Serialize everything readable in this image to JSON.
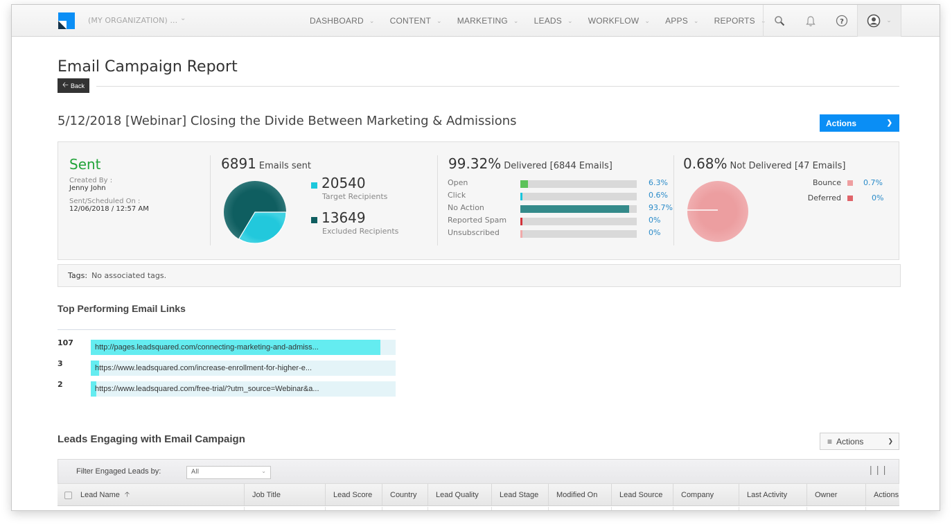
{
  "nav": {
    "org_name": "(MY ORGANIZATION) ...",
    "menu": [
      {
        "label": "DASHBOARD"
      },
      {
        "label": "CONTENT"
      },
      {
        "label": "MARKETING"
      },
      {
        "label": "LEADS"
      },
      {
        "label": "WORKFLOW"
      },
      {
        "label": "APPS"
      },
      {
        "label": "REPORTS"
      }
    ],
    "icons": [
      "search-icon",
      "bell-icon",
      "help-icon",
      "user-avatar-icon"
    ]
  },
  "page": {
    "title": "Email Campaign Report",
    "back_label": "Back",
    "campaign_title": "5/12/2018 [Webinar] Closing the Divide Between Marketing & Admissions",
    "actions_label": "Actions"
  },
  "summary": {
    "status": "Sent",
    "created_by_label": "Created By :",
    "created_by": "Jenny John",
    "sent_on_label": "Sent/Scheduled On :",
    "sent_on": "12/06/2018 / 12:57 AM",
    "emails_sent": {
      "count": "6891",
      "caption": "Emails sent",
      "target": {
        "value": "20540",
        "label": "Target Recipients",
        "color": "#1cc8dc"
      },
      "excluded": {
        "value": "13649",
        "label": "Excluded Recipients",
        "color": "#0f5e60"
      },
      "pie_share_target": 0.336
    },
    "delivered": {
      "percent": "99.32%",
      "caption": "Delivered [6844 Emails]",
      "rows": [
        {
          "label": "Open",
          "value": "6.3%",
          "fraction": 0.063,
          "color": "#5cc25a"
        },
        {
          "label": "Click",
          "value": "0.6%",
          "fraction": 0.006,
          "color": "#19c5dc"
        },
        {
          "label": "No Action",
          "value": "93.7%",
          "fraction": 0.937,
          "color": "#348a8a"
        },
        {
          "label": "Reported Spam",
          "value": "0%",
          "fraction": 0.0,
          "color": "#d3323a"
        },
        {
          "label": "Unsubscribed",
          "value": "0%",
          "fraction": 0.0,
          "color": "#f0aaaa"
        }
      ]
    },
    "not_delivered": {
      "percent": "0.68%",
      "caption": "Not Delivered [47 Emails]",
      "rows": [
        {
          "label": "Bounce",
          "value": "0.7%",
          "color": "#ee9ea0"
        },
        {
          "label": "Deferred",
          "value": "0%",
          "color": "#e0646a"
        }
      ]
    }
  },
  "tags": {
    "label": "Tags:",
    "value": "No associated tags."
  },
  "top_links": {
    "title": "Top Performing Email Links",
    "max": 107,
    "items": [
      {
        "count": "107",
        "value": 107,
        "url": "http://pages.leadsquared.com/connecting-marketing-and-admiss..."
      },
      {
        "count": "3",
        "value": 3,
        "url": "https://www.leadsquared.com/increase-enrollment-for-higher-e..."
      },
      {
        "count": "2",
        "value": 2,
        "url": "https://www.leadsquared.com/free-trial/?utm_source=Webinar&a..."
      }
    ]
  },
  "leads": {
    "title": "Leads Engaging with Email Campaign",
    "actions_label": "Actions",
    "filter_label": "Filter Engaged Leads by:",
    "filter_value": "All",
    "columns": [
      {
        "label": "Lead Name"
      },
      {
        "label": "Job Title"
      },
      {
        "label": "Lead Score"
      },
      {
        "label": "Country"
      },
      {
        "label": "Lead Quality"
      },
      {
        "label": "Lead Stage"
      },
      {
        "label": "Modified On"
      },
      {
        "label": "Lead Source"
      },
      {
        "label": "Company"
      },
      {
        "label": "Last Activity"
      },
      {
        "label": "Owner"
      },
      {
        "label": "Actions"
      }
    ]
  }
}
